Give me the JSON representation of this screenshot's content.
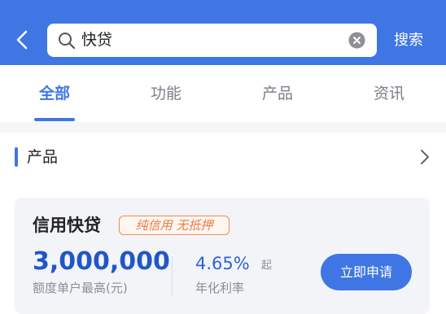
{
  "header": {
    "back_icon": "chevron-left-icon",
    "search": {
      "value": "快贷",
      "icon": "search-icon",
      "clear_icon": "clear-icon"
    },
    "search_button_label": "搜索",
    "background_color": "#3f76e4"
  },
  "tabs": [
    {
      "label": "全部",
      "active": true
    },
    {
      "label": "功能",
      "active": false
    },
    {
      "label": "产品",
      "active": false
    },
    {
      "label": "资讯",
      "active": false
    }
  ],
  "section": {
    "title": "产品",
    "chevron_icon": "chevron-right-icon"
  },
  "product_card": {
    "title": "信用快贷",
    "tag": "纯信用 无抵押",
    "amount": "3,000,000",
    "amount_label": "额度单户最高(元)",
    "rate": "4.65%",
    "rate_suffix": "起",
    "rate_label": "年化利率",
    "apply_button": "立即申请"
  },
  "colors": {
    "accent": "#3f76e4",
    "tag": "#ec7c45",
    "amount": "#2156c9"
  }
}
